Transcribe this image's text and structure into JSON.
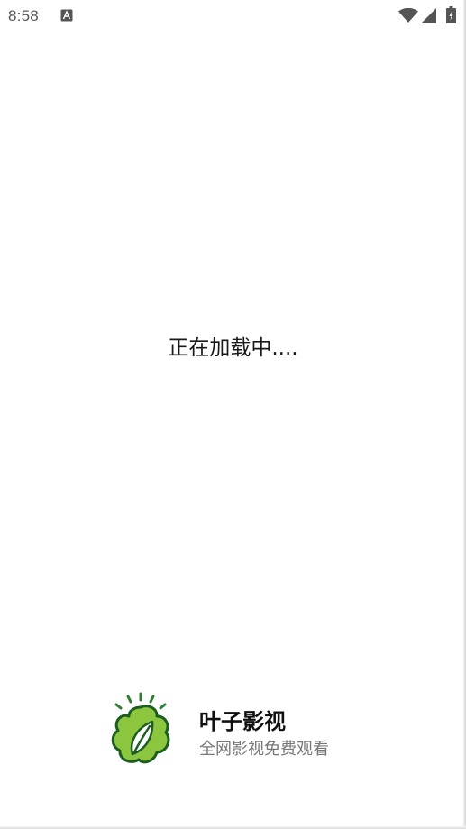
{
  "status_bar": {
    "time": "8:58",
    "icons": [
      "notification-a-icon",
      "wifi-icon",
      "cell-signal-icon",
      "battery-charging-icon"
    ]
  },
  "loading": {
    "text": "正在加载中...."
  },
  "brand": {
    "logo_icon": "leaf-logo-icon",
    "title": "叶子影视",
    "slogan": "全网影视免费观看",
    "colors": {
      "leaf_light": "#8cc63f",
      "leaf_dark": "#2e7d32",
      "outline": "#1b5e20"
    }
  }
}
